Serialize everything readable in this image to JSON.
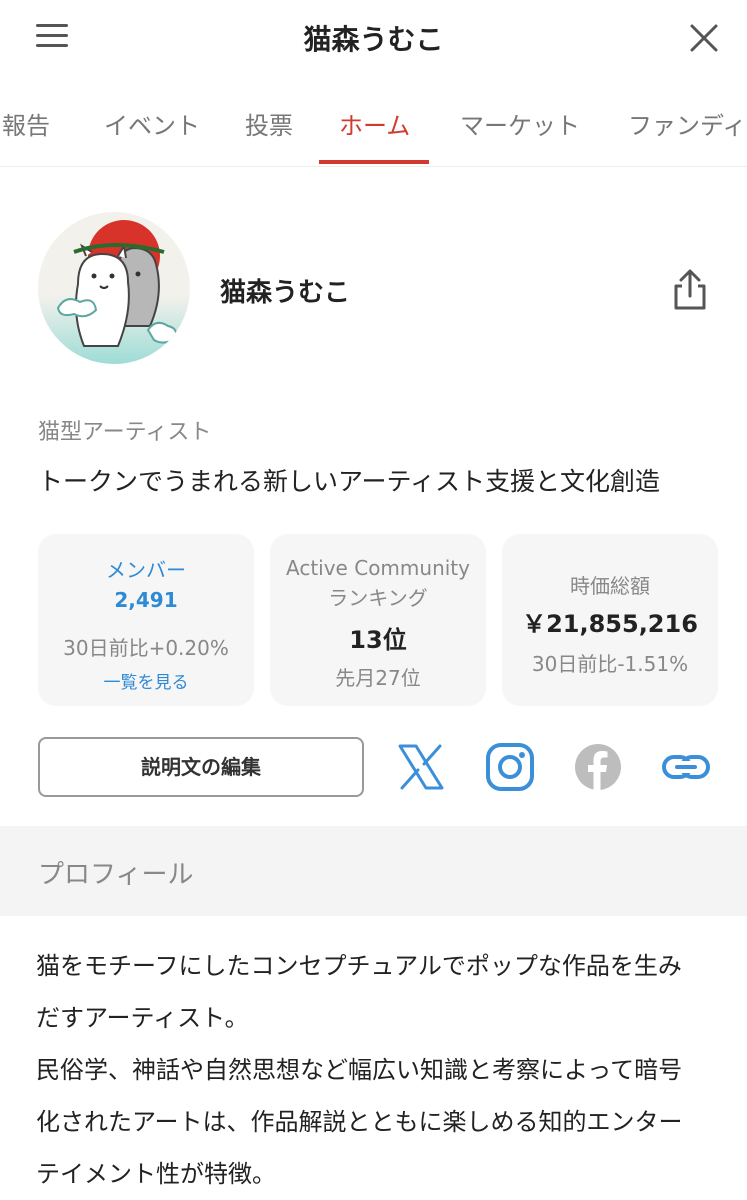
{
  "header": {
    "title": "猫森うむこ"
  },
  "tabs": [
    {
      "label": "の報告"
    },
    {
      "label": "イベント"
    },
    {
      "label": "投票"
    },
    {
      "label": "ホーム"
    },
    {
      "label": "マーケット"
    },
    {
      "label": "ファンディング"
    }
  ],
  "active_tab": "ホーム",
  "profile": {
    "name": "猫森うむこ",
    "category": "猫型アーティスト",
    "tagline": "トークンでうまれる新しいアーティスト支援と文化創造"
  },
  "stats": {
    "members": {
      "label": "メンバー",
      "value": "2,491",
      "change": "30日前比+0.20%",
      "link": "一覧を見る"
    },
    "ranking": {
      "label_line1": "Active Community",
      "label_line2": "ランキング",
      "value": "13位",
      "sub": "先月27位"
    },
    "market_cap": {
      "label": "時価総額",
      "value": "￥21,855,216",
      "change": "30日前比-1.51%"
    }
  },
  "actions": {
    "edit_label": "説明文の編集"
  },
  "social_icons": [
    "x-icon",
    "instagram-icon",
    "facebook-icon",
    "link-icon"
  ],
  "section": {
    "title": "プロフィール"
  },
  "description_lines": [
    "猫をモチーフにしたコンセプチュアルでポップな作品を生み",
    "だすアーティスト。",
    "民俗学、神話や自然思想など幅広い知識と考察によって暗号",
    "化されたアートは、作品解説とともに楽しめる知的エンター",
    "テイメント性が特徴。"
  ],
  "colors": {
    "accent": "#d23a2e",
    "link": "#2f8ad6",
    "card_bg": "#f6f6f6"
  }
}
